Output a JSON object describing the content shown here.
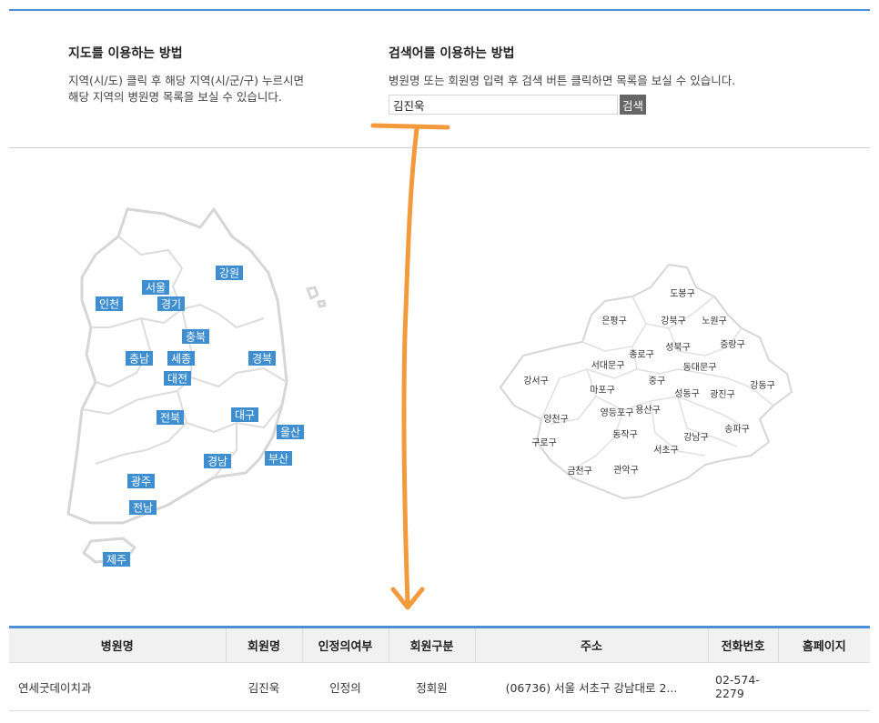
{
  "map_howto": {
    "title": "지도를 이용하는 방법",
    "line1": "지역(시/도) 클릭 후 해당 지역(시/군/구) 누르시면",
    "line2": "해당 지역의 병원명 목록을 보실 수 있습니다."
  },
  "search_howto": {
    "title": "검색어를 이용하는 방법",
    "line1": "병원명 또는 회원명 입력 후 검색 버튼 클릭하면 목록을 보실 수 있습니다.",
    "input_value": "김진욱",
    "button_label": "검색"
  },
  "korea_regions": [
    "서울",
    "경기",
    "인천",
    "강원",
    "충북",
    "충남",
    "세종",
    "대전",
    "경북",
    "전북",
    "대구",
    "울산",
    "경남",
    "부산",
    "광주",
    "전남",
    "제주"
  ],
  "seoul_districts": [
    "도봉구",
    "은평구",
    "강북구",
    "노원구",
    "종로구",
    "성북구",
    "중랑구",
    "강서구",
    "서대문구",
    "동대문구",
    "마포구",
    "중구",
    "성동구",
    "광진구",
    "강동구",
    "양천구",
    "영등포구",
    "용산구",
    "구로구",
    "동작구",
    "강남구",
    "송파구",
    "서초구",
    "금천구",
    "관악구"
  ],
  "table": {
    "headers": [
      "병원명",
      "회원명",
      "인정의여부",
      "회원구분",
      "주소",
      "전화번호",
      "홈페이지"
    ],
    "rows": [
      {
        "hospital": "연세굿데이치과",
        "member": "김진욱",
        "certified": "인정의",
        "type": "정회원",
        "address": "(06736) 서울 서초구 강남대로 2...",
        "phone1": "02-574-",
        "phone2": "2279",
        "homepage": ""
      }
    ]
  },
  "colors": {
    "accent": "#4a90d9",
    "label_bg": "#3e8ed0",
    "annotation": "#f39a3c"
  }
}
